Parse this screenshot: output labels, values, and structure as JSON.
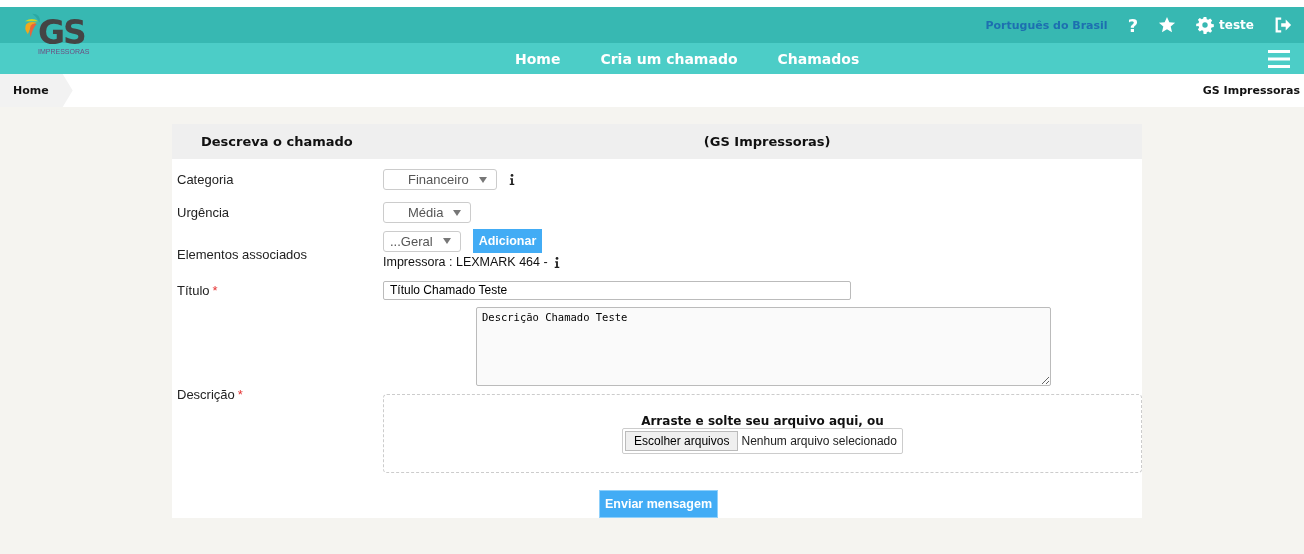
{
  "header": {
    "logo": {
      "text": "GS",
      "subtitle": "IMPRESSORAS"
    },
    "language": "Português do Brasil",
    "help": "?",
    "user": "teste"
  },
  "nav": [
    "Home",
    "Cria um chamado",
    "Chamados"
  ],
  "breadcrumb": {
    "current": "Home",
    "company": "GS Impressoras"
  },
  "form": {
    "title": "Descreva o chamado",
    "subtitle": "(GS Impressoras)",
    "fields": [
      {
        "kind": "select",
        "label": "Categoria",
        "value": "Financeiro",
        "info": true
      },
      {
        "kind": "select",
        "label": "Urgência",
        "value": "Média",
        "info": false
      },
      {
        "kind": "associated",
        "label": "Elementos associados",
        "value": "...Geral",
        "button": "Adicionar",
        "item": "Impressora : LEXMARK 464 -",
        "info": true
      },
      {
        "kind": "text",
        "label": "Título",
        "required_mark": "*",
        "value": "Título Chamado Teste"
      },
      {
        "kind": "description",
        "label": "Descrição",
        "required_mark": "*",
        "value": "Descrição Chamado Teste",
        "drop_text": "Arraste e solte seu arquivo aqui, ou",
        "file_button": "Escolher arquivos",
        "file_status": "Nenhum arquivo selecionado"
      }
    ],
    "submit": "Enviar mensagem"
  }
}
